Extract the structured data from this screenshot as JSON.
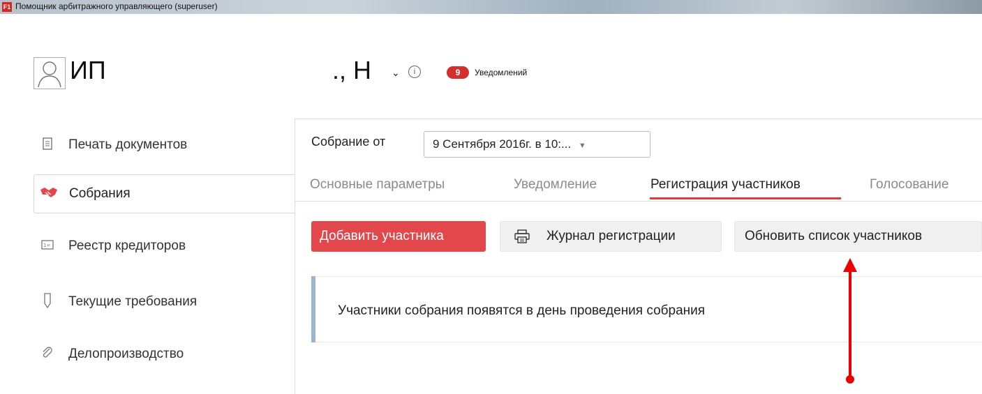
{
  "window": {
    "title": "Помощник арбитражного управляющего (superuser)",
    "app_icon": "F1"
  },
  "header": {
    "company_prefix": "ИП",
    "company_suffix": "., Н",
    "chevron": "⌄",
    "info_icon": "i",
    "notifications": {
      "count": "9",
      "label": "Уведомлений"
    }
  },
  "sidebar": {
    "items": [
      {
        "label": "Печать документов",
        "icon": "document-icon",
        "active": false
      },
      {
        "label": "Собрания",
        "icon": "handshake-icon",
        "active": true
      },
      {
        "label": "Реестр кредиторов",
        "icon": "id-card-icon",
        "active": false
      },
      {
        "label": "Текущие требования",
        "icon": "tag-icon",
        "active": false
      },
      {
        "label": "Делопроизводство",
        "icon": "paperclip-icon",
        "active": false
      }
    ]
  },
  "meeting": {
    "label": "Собрание от",
    "selected": "9 Сентября 2016г. в 10:..."
  },
  "tabs": [
    {
      "label": "Основные параметры",
      "active": false
    },
    {
      "label": "Уведомление",
      "active": false
    },
    {
      "label": "Регистрация участников",
      "active": true
    },
    {
      "label": "Голосование",
      "active": false
    }
  ],
  "toolbar": {
    "add_label": "Добавить участника",
    "journal_label": "Журнал регистрации",
    "refresh_label": "Обновить список участников"
  },
  "notice": {
    "text": "Участники собрания появятся в день проведения собрания"
  },
  "colors": {
    "accent_red": "#e2474b",
    "badge_red": "#d32f2f",
    "notice_bar": "#9bb4d0",
    "annotation": "#ee0000"
  }
}
